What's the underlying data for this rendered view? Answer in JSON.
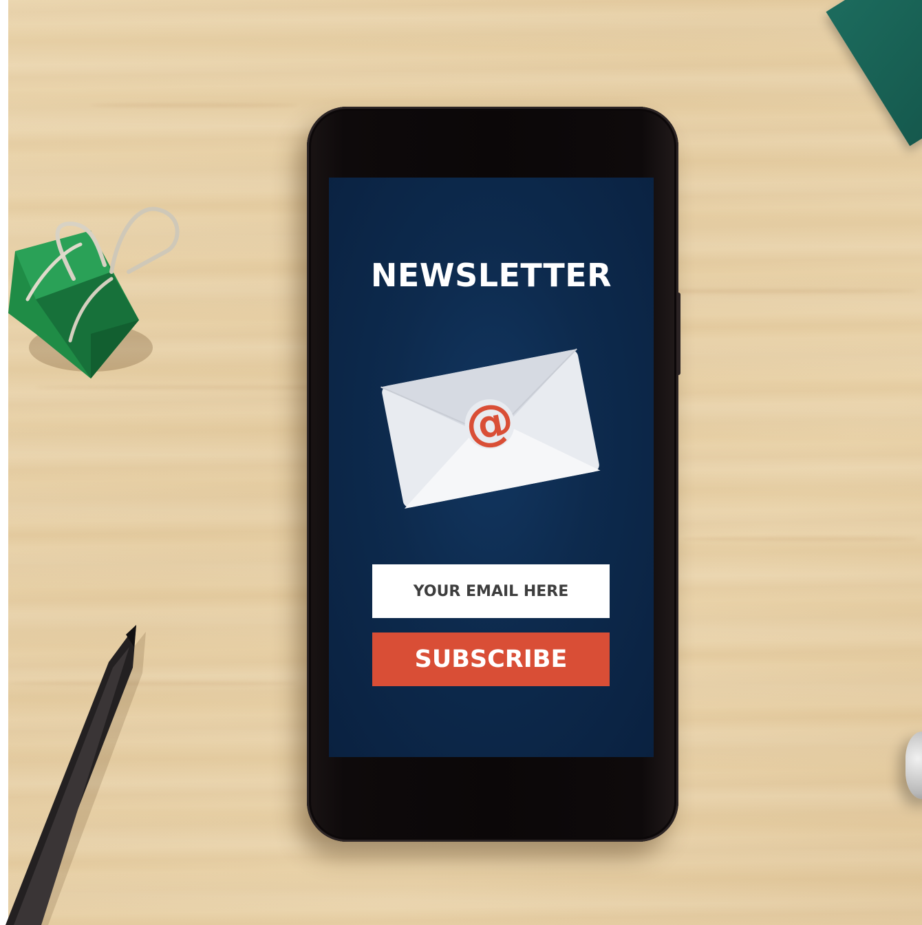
{
  "screen": {
    "title": "NEWSLETTER",
    "envelope_icon": "email-at-envelope-icon",
    "email_input": {
      "placeholder": "YOUR EMAIL HERE",
      "value": ""
    },
    "subscribe_button": {
      "label": "SUBSCRIBE"
    }
  },
  "colors": {
    "screen_background": "#0d2a4d",
    "button_red": "#d94e36",
    "at_symbol": "#d94e36",
    "envelope": "#e6e9ef",
    "desk_wood": "#e9d2a8",
    "clip_green": "#1e8a45",
    "folder_teal": "#1c6b5d"
  },
  "scene_objects": [
    "binder-clip",
    "pencil",
    "smartphone",
    "teal-folder",
    "bottle-cap"
  ]
}
